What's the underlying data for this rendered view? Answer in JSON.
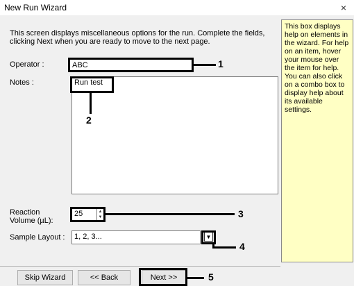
{
  "window": {
    "title": "New Run Wizard",
    "close_glyph": "×"
  },
  "intro_text": "This screen displays miscellaneous options for the run. Complete the fields, clicking Next when you are ready to move to the next page.",
  "fields": {
    "operator_label": "Operator :",
    "operator_value": "ABC",
    "notes_label": "Notes :",
    "notes_value": "Run test",
    "reaction_volume_label_1": "Reaction",
    "reaction_volume_label_2": "Volume (µL):",
    "reaction_volume_value": "25",
    "sample_layout_label": "Sample Layout :",
    "sample_layout_value": "1, 2, 3..."
  },
  "help_text": "This box displays help on elements in the wizard. For help on an item, hover your mouse over the item for help. You can also click on a combo box to display help about its available settings.",
  "buttons": {
    "skip": "Skip Wizard",
    "back": "<< Back",
    "next": "Next >>"
  },
  "annotations": [
    "1",
    "2",
    "3",
    "4",
    "5"
  ]
}
